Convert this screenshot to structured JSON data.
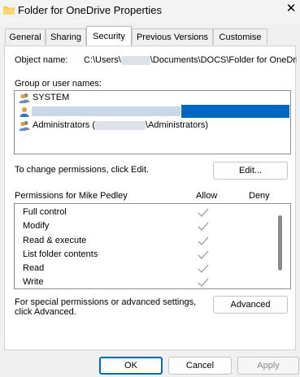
{
  "window": {
    "title": "Folder for OneDrive Properties"
  },
  "tabs": [
    "General",
    "Sharing",
    "Security",
    "Previous Versions",
    "Customise"
  ],
  "security": {
    "object_name_label": "Object name:",
    "object_path_prefix": "C:\\Users\\",
    "object_path_suffix": "\\Documents\\DOCS\\Folder for OneDriv",
    "group_label": "Group or user names:",
    "groups": {
      "system": "SYSTEM",
      "admins_prefix": "Administrators (",
      "admins_suffix": "\\Administrators)"
    },
    "change_hint": "To change permissions, click Edit.",
    "edit_button": "Edit...",
    "perm_header": "Permissions for Mike Pedley",
    "allow_header": "Allow",
    "deny_header": "Deny",
    "permissions": [
      "Full control",
      "Modify",
      "Read & execute",
      "List folder contents",
      "Read",
      "Write"
    ],
    "special_hint": "For special permissions or advanced settings, click Advanced.",
    "advanced_button": "Advanced"
  },
  "footer": {
    "ok": "OK",
    "cancel": "Cancel",
    "apply": "Apply"
  },
  "colors": {
    "selection": "#0067c0",
    "check": "#a0a0a0"
  }
}
